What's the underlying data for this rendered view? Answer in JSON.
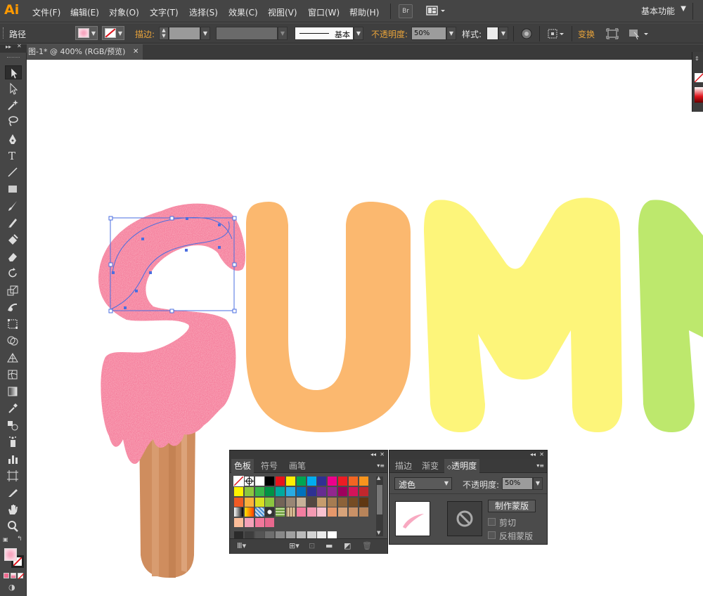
{
  "app": {
    "logo": "Ai",
    "workspace": "基本功能"
  },
  "menu": [
    "文件(F)",
    "编辑(E)",
    "对象(O)",
    "文字(T)",
    "选择(S)",
    "效果(C)",
    "视图(V)",
    "窗口(W)",
    "帮助(H)"
  ],
  "menubar_bridge": "Br",
  "control": {
    "object_type": "路径",
    "stroke_label": "描边:",
    "stroke_style": "基本",
    "opacity_label": "不透明度:",
    "opacity_value": "50%",
    "style_label": "样式:",
    "transform_label": "变换"
  },
  "document": {
    "tab_title": "图-1* @ 400% (RGB/预览)"
  },
  "artwork": {
    "letters": [
      "S",
      "U",
      "M",
      "M"
    ],
    "colors": {
      "pink": "#f5628c",
      "orange": "#fbb86f",
      "yellow": "#fdf57a",
      "green": "#bde86d",
      "stick": "#cf8d5e"
    }
  },
  "swatches_panel": {
    "tabs": [
      "色板",
      "符号",
      "画笔"
    ],
    "rows": [
      [
        "none",
        "reg",
        "#ffffff",
        "#000000",
        "#e8141c",
        "#ffee00",
        "#00a651",
        "#00adef",
        "#2e3192",
        "#ec008c",
        "#ed1c24",
        "#f26522",
        "#f7941d"
      ],
      [
        "#fff200",
        "#8dc63f",
        "#39b54a",
        "#009245",
        "#00a99d",
        "#29abe2",
        "#0072bc",
        "#2e3192",
        "#662d91",
        "#92278f",
        "#9e005d",
        "#d4145a",
        "#c1272d"
      ],
      [
        "#f15a24",
        "#fbb03b",
        "#d9e021",
        "#8cc63f",
        "#736357",
        "#998675",
        "#c7b299",
        "#534741",
        "#c69c6d",
        "#a67c52",
        "#8c6239",
        "#754c24",
        "#603813"
      ],
      [
        "grad1",
        "grad2",
        "pat1",
        "pat2",
        "pat3",
        "pat4",
        "#f37da0",
        "#f49ab3",
        "#f8c2d0",
        "#e6986b",
        "#d7a37a",
        "#c99167",
        "#b8845a"
      ],
      [
        "#fbbd9a",
        "#f4a1b8",
        "#f2789c",
        "#e9688e"
      ],
      [
        "#2b2b2b",
        "#3d3d3d",
        "#555555",
        "#6e6e6e",
        "#888888",
        "#a0a0a0",
        "#bababa",
        "#d3d3d3",
        "#ebebeb",
        "#ffffff"
      ]
    ]
  },
  "transparency_panel": {
    "tabs": [
      "描边",
      "渐变",
      "透明度"
    ],
    "blend_mode": "滤色",
    "opacity_label": "不透明度:",
    "opacity_value": "50%",
    "make_mask_button": "制作蒙版",
    "clip_label": "剪切",
    "invert_label": "反相蒙版"
  }
}
